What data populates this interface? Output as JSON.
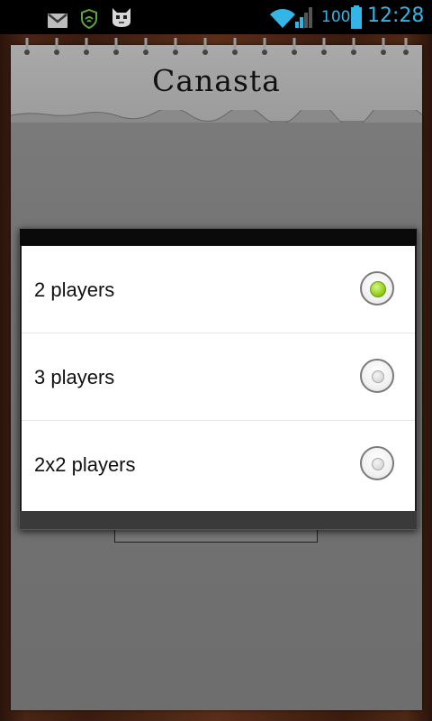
{
  "status_bar": {
    "battery_level": "100",
    "time": "12:28",
    "icons": [
      "gmail-icon",
      "vpn-shield-icon",
      "cyanogen-mascot-icon",
      "wifi-icon",
      "cell-signal-icon",
      "battery-icon"
    ]
  },
  "app": {
    "title": "Canasta"
  },
  "dialog": {
    "options": [
      {
        "label": "2 players",
        "selected": true
      },
      {
        "label": "3 players",
        "selected": false
      },
      {
        "label": "2x2 players",
        "selected": false
      }
    ]
  },
  "colors": {
    "status_accent": "#33b5e5",
    "radio_selected": "#9ad321"
  }
}
